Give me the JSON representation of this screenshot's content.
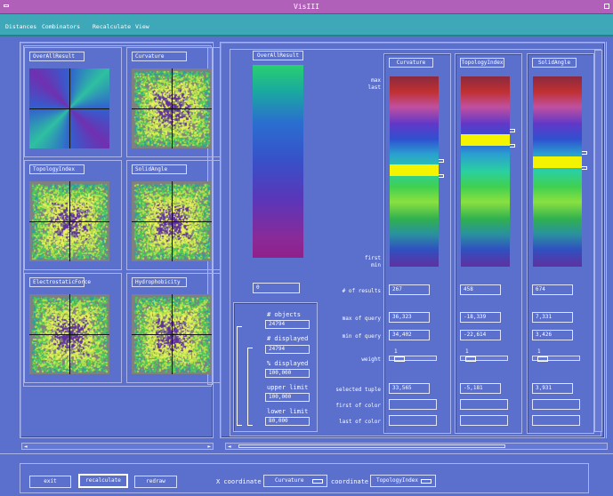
{
  "window": {
    "title": "VisIII"
  },
  "menu": [
    "Distances",
    "Combinators",
    "Recalculate",
    "View"
  ],
  "thumbnails": [
    {
      "label": "OverAllResult",
      "kind": "gradient"
    },
    {
      "label": "Curvature",
      "kind": "noise"
    },
    {
      "label": "TopologyIndex",
      "kind": "noise"
    },
    {
      "label": "SolidAngle",
      "kind": "noise"
    },
    {
      "label": "ElectrostaticForce",
      "kind": "noise"
    },
    {
      "label": "Hydrophobicity",
      "kind": "noise"
    }
  ],
  "overall": {
    "label": "OverAllResult",
    "value": "0"
  },
  "colorbar_labels": {
    "max": "max",
    "last": "last",
    "first": "first",
    "min": "min"
  },
  "stats": {
    "objects_label": "# objects",
    "objects": "24794",
    "displayed_label": "# displayed",
    "displayed": "24794",
    "pct_label": "% displayed",
    "pct": "100,000",
    "upper_label": "upper limit",
    "upper": "100,000",
    "lower_label": "lower limit",
    "lower": "80,000"
  },
  "row_labels": {
    "results": "# of results",
    "max": "max of query",
    "min": "min of query",
    "weight": "weight",
    "selected": "selected tuple",
    "first": "first of color",
    "last": "last of color"
  },
  "columns": [
    {
      "label": "Curvature",
      "results": "267",
      "max": "36,323",
      "min": "34,402",
      "weight": "1",
      "weight_fraction": 0.1,
      "selected": "33,565",
      "band_pos": 0.49
    },
    {
      "label": "TopologyIndex",
      "results": "458",
      "max": "-18,339",
      "min": "-22,614",
      "weight": "1",
      "weight_fraction": 0.1,
      "selected": "-5,181",
      "band_pos": 0.33
    },
    {
      "label": "SolidAngle",
      "results": "674",
      "max": "7,331",
      "min": "3,426",
      "weight": "1",
      "weight_fraction": 0.1,
      "selected": "3,931",
      "band_pos": 0.45
    }
  ],
  "buttons": {
    "exit": "exit",
    "recalculate": "recalculate",
    "redraw": "redraw"
  },
  "x_coord": {
    "label": "X coordinate :",
    "value": "Curvature"
  },
  "y_coord": {
    "label": "coordinate :",
    "value": "TopologyIndex"
  },
  "colors": {
    "background": "#5a70cc",
    "titlebar": "#b060b8",
    "menubar": "#3fa8b8",
    "highlight": "#f4f400"
  }
}
